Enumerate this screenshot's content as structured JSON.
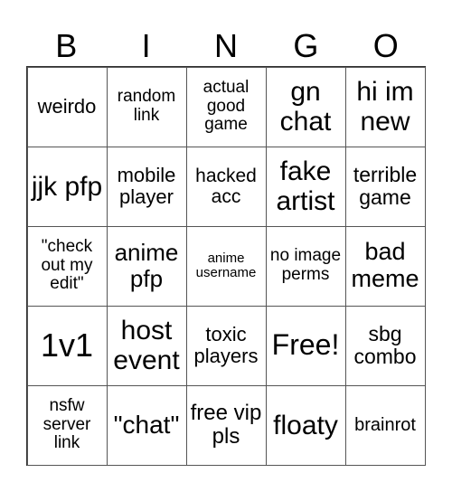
{
  "header": [
    "B",
    "I",
    "N",
    "G",
    "O"
  ],
  "cells": [
    "weirdo",
    "random link",
    "actual good game",
    "gn chat",
    "hi im new",
    "jjk pfp",
    "mobile player",
    "hacked acc",
    "fake artist",
    "terrible game",
    "\"check out my edit\"",
    "anime pfp",
    "anime username",
    "no image perms",
    "bad meme",
    "1v1",
    "host event",
    "toxic players",
    "Free!",
    "sbg combo",
    "nsfw server link",
    "\"chat\"",
    "free vip pls",
    "floaty",
    "brainrot"
  ]
}
